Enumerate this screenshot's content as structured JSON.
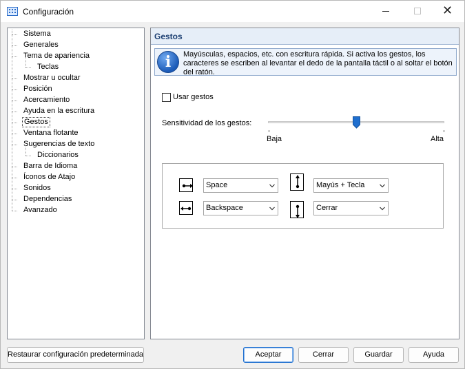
{
  "window": {
    "title": "Configuración",
    "icon": "keyboard-icon"
  },
  "tree": {
    "items": [
      {
        "label": "Sistema",
        "level": 0
      },
      {
        "label": "Generales",
        "level": 0
      },
      {
        "label": "Tema de apariencia",
        "level": 0
      },
      {
        "label": "Teclas",
        "level": 1
      },
      {
        "label": "Mostrar u ocultar",
        "level": 0
      },
      {
        "label": "Posición",
        "level": 0
      },
      {
        "label": "Acercamiento",
        "level": 0
      },
      {
        "label": "Ayuda en la escritura",
        "level": 0
      },
      {
        "label": "Gestos",
        "level": 0,
        "selected": true
      },
      {
        "label": "Ventana flotante",
        "level": 0
      },
      {
        "label": "Sugerencias de texto",
        "level": 0
      },
      {
        "label": "Diccionarios",
        "level": 1
      },
      {
        "label": "Barra de Idioma",
        "level": 0
      },
      {
        "label": "Íconos de Atajo",
        "level": 0
      },
      {
        "label": "Sonidos",
        "level": 0
      },
      {
        "label": "Dependencias",
        "level": 0
      },
      {
        "label": "Avanzado",
        "level": 0
      }
    ]
  },
  "panel": {
    "title": "Gestos",
    "info": "Mayúsculas, espacios, etc. con escritura rápida. Si activa los gestos, los caracteres se escriben al levantar el dedo de la pantalla táctil o al soltar el botón del ratón.",
    "use_gestures_label": "Usar gestos",
    "use_gestures_checked": false,
    "sensitivity_label": "Sensitividad de los gestos:",
    "sensitivity_min_label": "Baja",
    "sensitivity_max_label": "Alta",
    "sensitivity_value": 0.5
  },
  "gestures": {
    "swipe_right": "Space",
    "swipe_left": "Backspace",
    "swipe_up": "Mayús + Tecla",
    "swipe_down": "Cerrar"
  },
  "buttons": {
    "restore": "Restaurar configuración predeterminada",
    "accept": "Aceptar",
    "cancel": "Cerrar",
    "save": "Guardar",
    "help": "Ayuda"
  },
  "colors": {
    "accent": "#1f6fcf",
    "header_bg": "#e6eef8",
    "info_bg": "#edf3fb",
    "header_text": "#1c3f72"
  }
}
